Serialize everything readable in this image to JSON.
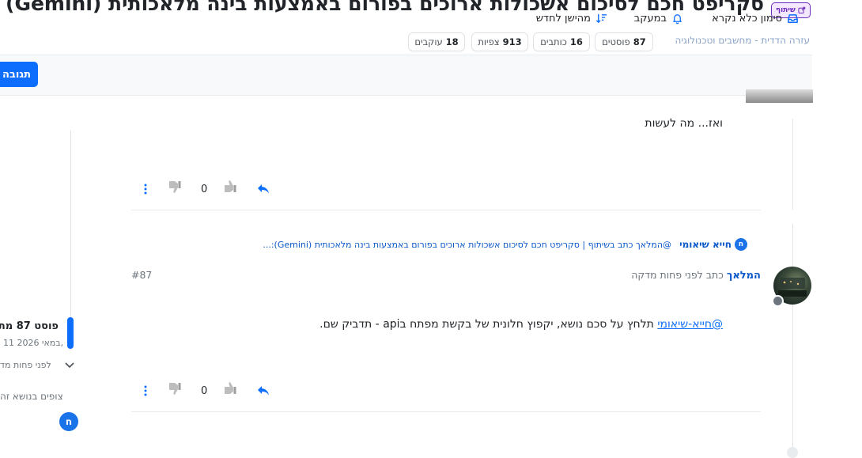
{
  "topic": {
    "title": "סקריפט חכם לסיכום אשכולות ארוכים בפורום באמצעות בינה מלאכותית (Gemini)",
    "share_badge": "שיתוף"
  },
  "meta": {
    "breadcrumb": "עזרה הדדית - מחשבים וטכנולוגיה",
    "posts_count": "87",
    "posts_label": "פוסטים",
    "writers_count": "16",
    "writers_label": "כותבים",
    "views_count": "913",
    "views_label": "צפיות",
    "followers_count": "18",
    "followers_label": "עוקבים"
  },
  "toolbar": {
    "mark_read": "סימון כלא נקרא",
    "watching": "במעקב",
    "sort": "מהישן לחדש",
    "reply": "תגובה"
  },
  "post_prev": {
    "text": "ואז... מה לעשות",
    "votes": "0"
  },
  "post": {
    "parent_author": "חייא שיאומי",
    "parent_initial": "ח",
    "parent_text": "@המלאך כתב בשיתוף | סקריפט חכם לסיכום אשכולות ארוכים בפורום באמצעות בינה מלאכותית (Gemini):...",
    "author": "המלאך",
    "written_label": "כתב לפני פחות מדקה",
    "number": "#87",
    "mention": "@חייא-שיאומי",
    "body_rest": " תלחץ על סכם נושא, יקפוץ חלונית של בקשת מפתח בapi - תדביק שם.",
    "votes": "0"
  },
  "sidebar": {
    "post_index": "פוסט 87 מת",
    "date": "11 במאי 2026,",
    "ago": "לפני פחות מד",
    "viewers": "צופים בנושא זה",
    "viewer_initial": "ח"
  },
  "colors": {
    "accent": "#0d6efd",
    "link": "#0a58ca",
    "share_purple": "#6f2dbd"
  }
}
